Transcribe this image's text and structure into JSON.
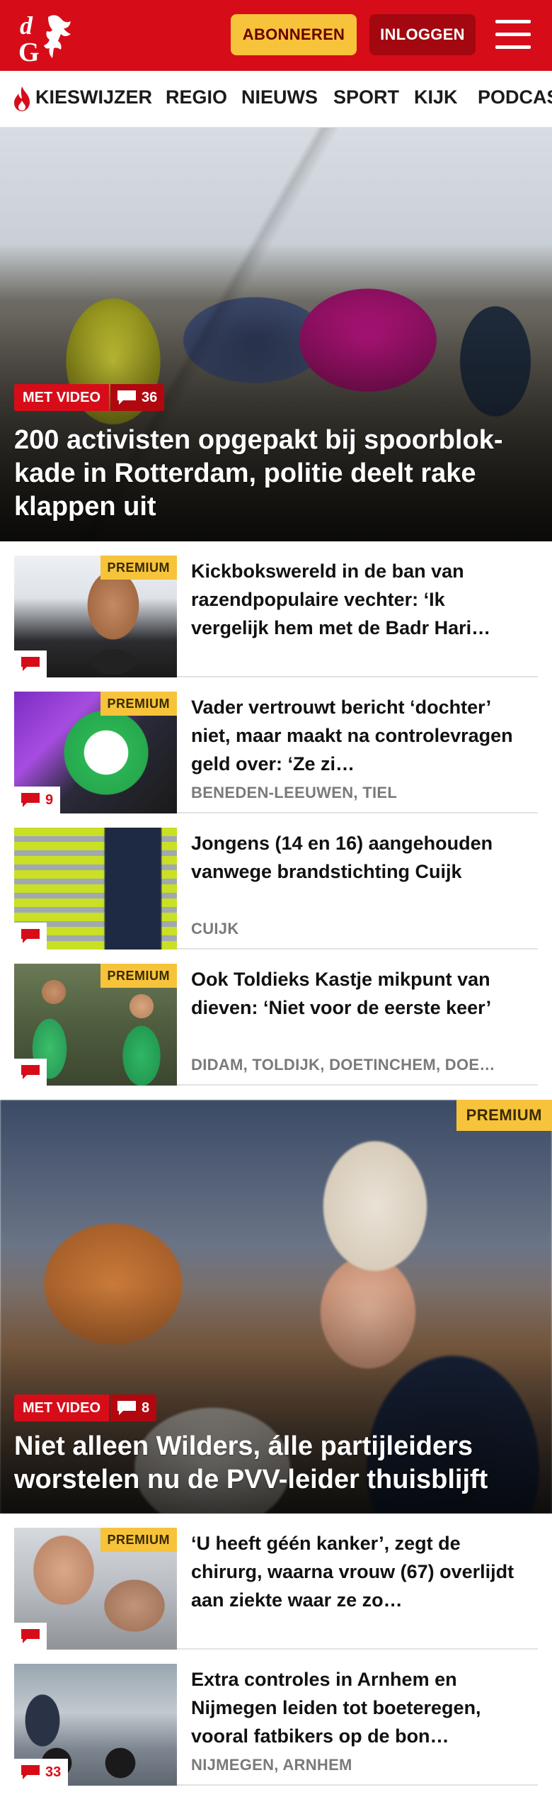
{
  "header": {
    "subscribe_label": "ABONNEREN",
    "login_label": "INLOGGEN",
    "logo_text": "dG",
    "brand_color": "#d60d19"
  },
  "nav": {
    "items": [
      "KIESWIJZER",
      "REGIO",
      "NIEUWS",
      "SPORT",
      "KIJK",
      "PODCAS"
    ]
  },
  "hero1": {
    "video_label": "MET VIDEO",
    "comments": "36",
    "title": "200 activisten opgepakt bij spoorblok-kade in Rotterdam, politie deelt rake klappen uit"
  },
  "articles1": [
    {
      "title": "Kickbokswereld in de ban van razendpopulaire vechter: ‘Ik vergelijk hem met de Badr Hari…",
      "premium": "PREMIUM",
      "comments": "",
      "location": ""
    },
    {
      "title": "Vader vertrouwt bericht ‘dochter’ niet, maar maakt na controlevragen geld over: ‘Ze zi…",
      "premium": "PREMIUM",
      "comments": "9",
      "location": "BENEDEN-LEEUWEN, TIEL"
    },
    {
      "title": "Jongens (14 en 16) aangehouden vanwege brandstichting Cuijk",
      "premium": "",
      "comments": "",
      "location": "CUIJK"
    },
    {
      "title": "Ook Toldieks Kastje mikpunt van dieven: ‘Niet voor de eerste keer’",
      "premium": "PREMIUM",
      "comments": "",
      "location": "DIDAM, TOLDIJK, DOETINCHEM, DOE…"
    }
  ],
  "hero2": {
    "premium": "PREMIUM",
    "video_label": "MET VIDEO",
    "comments": "8",
    "title": "Niet alleen Wilders, álle partijleiders worstelen nu de PVV-leider thuisblijft"
  },
  "articles2": [
    {
      "title": "‘U heeft géén kanker’, zegt de chirurg, waarna vrouw (67) overlijdt aan ziekte waar ze zo…",
      "premium": "PREMIUM",
      "comments": "",
      "location": ""
    },
    {
      "title": "Extra controles in Arnhem en Nijmegen leiden tot boeteregen, vooral fatbikers op de bon…",
      "premium": "",
      "comments": "33",
      "location": "NIJMEGEN, ARNHEM"
    }
  ]
}
